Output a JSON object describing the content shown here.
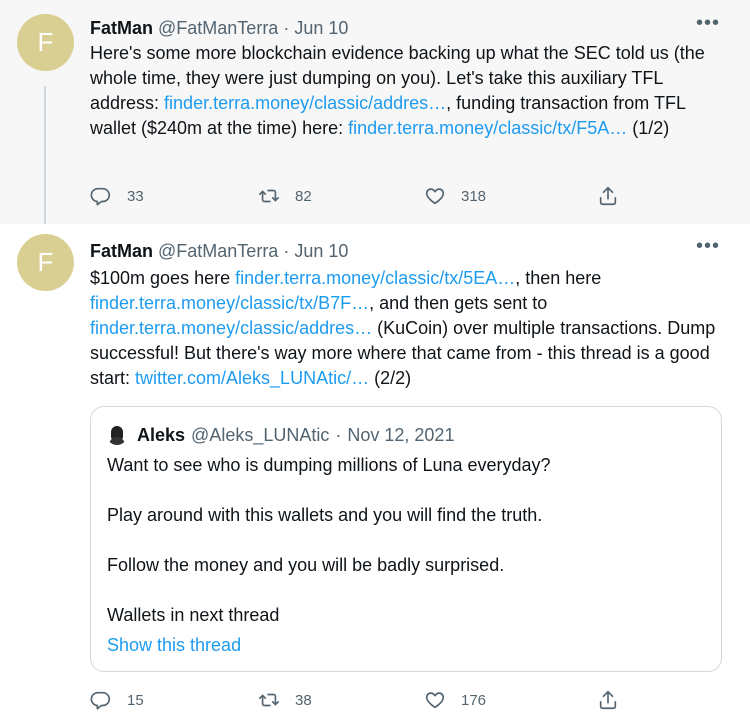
{
  "tweets": [
    {
      "avatar_letter": "F",
      "name": "FatMan",
      "handle": "@FatManTerra",
      "separator": "·",
      "date": "Jun 10",
      "more": "•••",
      "body": [
        {
          "text": "Here's some more blockchain evidence backing up what the SEC told us (the whole time, they were just dumping on you). Let's take this auxiliary TFL address: ",
          "link": false
        },
        {
          "text": "finder.terra.money/classic/addres…",
          "link": true
        },
        {
          "text": ", funding transaction from TFL wallet ($240m at the time) here: ",
          "link": false
        },
        {
          "text": "finder.terra.money/classic/tx/F5A…",
          "link": true
        },
        {
          "text": " (1/2)",
          "link": false
        }
      ],
      "actions": {
        "replies": "33",
        "retweets": "82",
        "likes": "318"
      }
    },
    {
      "avatar_letter": "F",
      "name": "FatMan",
      "handle": "@FatManTerra",
      "separator": "·",
      "date": "Jun 10",
      "more": "•••",
      "body": [
        {
          "text": "$100m goes here ",
          "link": false
        },
        {
          "text": "finder.terra.money/classic/tx/5EA…",
          "link": true
        },
        {
          "text": ", then here ",
          "link": false
        },
        {
          "text": "finder.terra.money/classic/tx/B7F…",
          "link": true
        },
        {
          "text": ", and then gets sent to ",
          "link": false
        },
        {
          "text": "finder.terra.money/classic/addres…",
          "link": true
        },
        {
          "text": " (KuCoin) over multiple transactions. Dump successful! But there's way more where that came from - this thread is a good start: ",
          "link": false
        },
        {
          "text": "twitter.com/Aleks_LUNAtic/…",
          "link": true
        },
        {
          "text": " (2/2)",
          "link": false
        }
      ],
      "actions": {
        "replies": "15",
        "retweets": "38",
        "likes": "176"
      }
    }
  ],
  "quote": {
    "name": "Aleks",
    "handle": "@Aleks_LUNAtic",
    "separator": "·",
    "date": "Nov 12, 2021",
    "lines": [
      "Want to see who is dumping millions of Luna everyday?",
      "Play around with this wallets and you will find the truth.",
      "Follow the money and you will be badly surprised.",
      "Wallets in next thread"
    ],
    "show_thread": "Show this thread"
  },
  "icons": {
    "reply": "reply-icon",
    "retweet": "retweet-icon",
    "like": "like-icon",
    "share": "share-icon",
    "more": "more-icon"
  },
  "colors": {
    "link": "#1d9bf0",
    "muted": "#536471",
    "avatar": "#d9cf92",
    "highlight_bg": "#f7f7f7"
  }
}
